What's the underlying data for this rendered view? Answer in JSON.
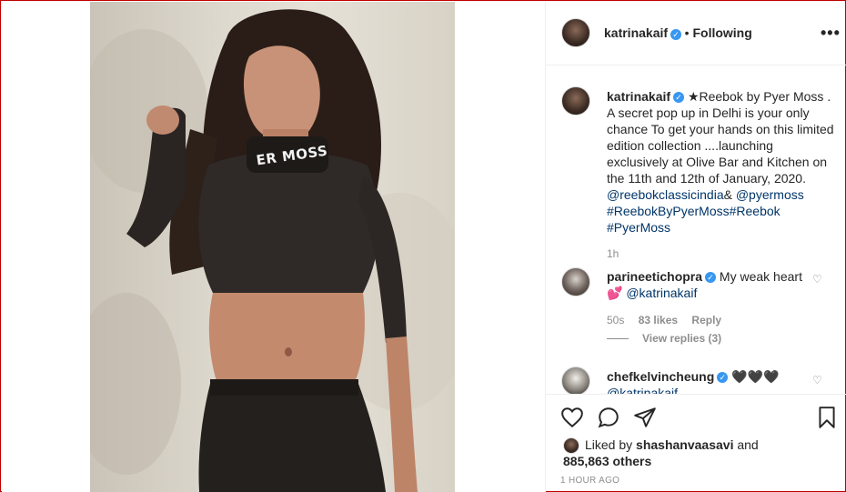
{
  "post": {
    "author": "katrinakaif",
    "follow_state": "Following",
    "more_label": "•••",
    "caption_prefix": "★Reebok by Pyer Moss . A secret pop up in Delhi is your only chance To get your hands on this limited edition collection ....launching exclusively at Olive Bar and Kitchen on the 11th and 12th of January, 2020.",
    "caption_mention1": "@reebokclassicindia",
    "caption_amp": "& ",
    "caption_mention2": "@pyermoss",
    "caption_tags1": "#ReebokByPyerMoss",
    "caption_tags2": "#Reebok",
    "caption_tags3": "#PyerMoss",
    "caption_time": "1h",
    "shirt_text": "ER MOSS"
  },
  "comments": [
    {
      "user": "parineetichopra",
      "text": "My weak heart",
      "text2_prefix": "💕",
      "mention": "@katrinakaif",
      "time": "50s",
      "likes": "83 likes",
      "reply": "Reply",
      "view_replies": "View replies (3)"
    },
    {
      "user": "chefkelvincheung",
      "text": "🖤🖤🖤",
      "mention": "@katrinakaif"
    }
  ],
  "likes": {
    "prefix": "Liked by",
    "user": "shashanvaasavi",
    "and": "and",
    "count": "885,863 others"
  },
  "timestamp": "1 HOUR AGO",
  "icons": {
    "like": "heart-icon",
    "comment": "comment-icon",
    "share": "share-icon",
    "save": "bookmark-icon",
    "verified": "verified-badge-icon"
  },
  "colors": {
    "link": "#003569",
    "verified": "#3897f0",
    "muted": "#8e8e8e"
  }
}
